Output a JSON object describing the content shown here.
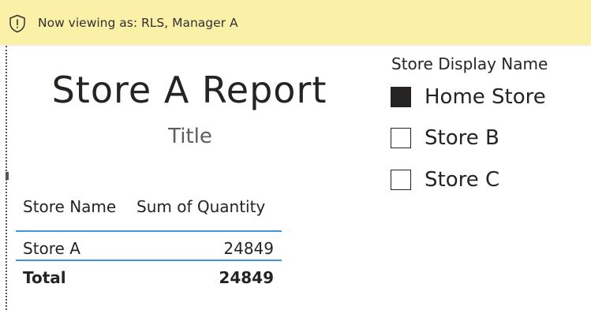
{
  "banner": {
    "text": "Now viewing as: RLS, Manager A",
    "icon": "shield-alert-icon",
    "background": "#fbf0a8"
  },
  "report": {
    "title": "Store A Report",
    "subtitle": "Title"
  },
  "table": {
    "headers": [
      "Store Name",
      "Sum of Quantity"
    ],
    "rows": [
      [
        "Store A",
        "24849"
      ]
    ],
    "total": [
      "Total",
      "24849"
    ],
    "accent": "#3a96dd"
  },
  "slicer": {
    "title": "Store Display Name",
    "items": [
      {
        "label": "Home Store",
        "checked": true
      },
      {
        "label": "Store B",
        "checked": false
      },
      {
        "label": "Store C",
        "checked": false
      }
    ]
  }
}
